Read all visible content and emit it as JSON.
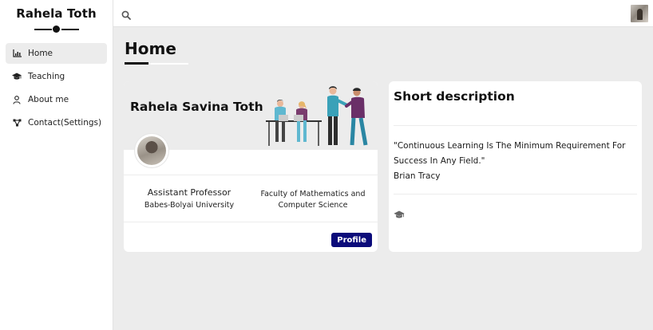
{
  "sidebar": {
    "brand_name": "Rahela Toth",
    "items": [
      {
        "label": "Home",
        "icon": "chart-icon",
        "active": true
      },
      {
        "label": "Teaching",
        "icon": "graduation-cap-icon",
        "active": false
      },
      {
        "label": "About me",
        "icon": "user-icon",
        "active": false
      },
      {
        "label": "Contact(Settings)",
        "icon": "share-nodes-icon",
        "active": false
      }
    ]
  },
  "topbar": {
    "search_icon": "search-icon",
    "avatar": "user-avatar"
  },
  "main": {
    "page_title": "Home",
    "profile_card": {
      "name": "Rahela Savina Toth",
      "role": "Assistant Professor",
      "university": "Babes-Bolyai University",
      "faculty": "Faculty of Mathematics and Computer Science",
      "button_label": "Profile"
    },
    "description_card": {
      "title": "Short description",
      "quote": "\"Continuous Learning Is The Minimum Requirement For Success In Any Field.\"",
      "author": "Brian Tracy",
      "icon": "graduation-cap-icon"
    }
  },
  "colors": {
    "background": "#ececec",
    "accent_button": "#0b0b7a",
    "text": "#111111"
  }
}
